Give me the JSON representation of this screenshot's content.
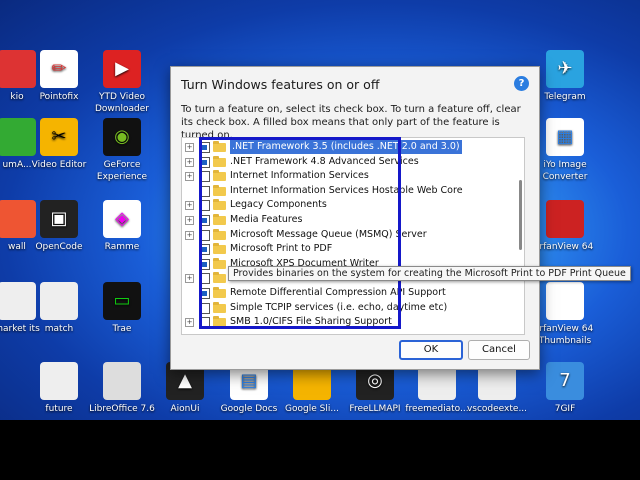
{
  "dialog": {
    "title": "Turn Windows features on or off",
    "help_glyph": "?",
    "description": "To turn a feature on, select its check box. To turn a feature off, clear its check box. A filled box means that only part of the feature is turned on.",
    "features": [
      {
        "label": ".NET Framework 3.5 (includes .NET 2.0 and 3.0)",
        "expandable": true,
        "state": "partial",
        "selected": true
      },
      {
        "label": ".NET Framework 4.8 Advanced Services",
        "expandable": true,
        "state": "partial",
        "selected": false
      },
      {
        "label": "Internet Information Services",
        "expandable": true,
        "state": "off",
        "selected": false
      },
      {
        "label": "Internet Information Services Hostable Web Core",
        "expandable": false,
        "state": "off",
        "selected": false
      },
      {
        "label": "Legacy Components",
        "expandable": true,
        "state": "off",
        "selected": false
      },
      {
        "label": "Media Features",
        "expandable": true,
        "state": "partial",
        "selected": false
      },
      {
        "label": "Microsoft Message Queue (MSMQ) Server",
        "expandable": true,
        "state": "off",
        "selected": false
      },
      {
        "label": "Microsoft Print to PDF",
        "expandable": false,
        "state": "partial",
        "selected": false
      },
      {
        "label": "Microsoft XPS Document Writer",
        "expandable": false,
        "state": "partial",
        "selected": false
      },
      {
        "label": "",
        "expandable": true,
        "state": "off",
        "selected": false
      },
      {
        "label": "Remote Differential Compression API Support",
        "expandable": false,
        "state": "partial",
        "selected": false
      },
      {
        "label": "Simple TCPIP services (i.e. echo, daytime etc)",
        "expandable": false,
        "state": "off",
        "selected": false
      },
      {
        "label": "SMB 1.0/CIFS File Sharing Support",
        "expandable": true,
        "state": "off",
        "selected": false
      }
    ],
    "tooltip": "Provides binaries on the system for creating the Microsoft Print to PDF Print Queue",
    "ok_label": "OK",
    "cancel_label": "Cancel"
  },
  "desktop_icons": [
    {
      "label": "kio",
      "glyph": "🎵",
      "color": "#d33"
    },
    {
      "label": "Pointofix",
      "glyph": "✏",
      "color": "#fff"
    },
    {
      "label": "YTD Video Downloader",
      "glyph": "▶",
      "color": "#d22"
    },
    {
      "label": "umA...",
      "glyph": "▮",
      "color": "#3a3"
    },
    {
      "label": "Video Editor",
      "glyph": "✂",
      "color": "#f5b400"
    },
    {
      "label": "GeForce Experience",
      "glyph": "◉",
      "color": "#111"
    },
    {
      "label": "wall",
      "glyph": "🔥",
      "color": "#e53"
    },
    {
      "label": "OpenCode",
      "glyph": "▣",
      "color": "#222"
    },
    {
      "label": "Ramme",
      "glyph": "📷",
      "color": "#e0e"
    },
    {
      "label": "market its",
      "glyph": "📄",
      "color": "#eee"
    },
    {
      "label": "match",
      "glyph": "📄",
      "color": "#eee"
    },
    {
      "label": "Trae",
      "glyph": "▭",
      "color": "#1c1"
    },
    {
      "label": "future",
      "glyph": "📄",
      "color": "#eee"
    },
    {
      "label": "LibreOffice 7.6",
      "glyph": "📝",
      "color": "#ddd"
    },
    {
      "label": "AionUi",
      "glyph": "▲",
      "color": "#222"
    },
    {
      "label": "Google Docs",
      "glyph": "📘",
      "color": "#fff"
    },
    {
      "label": "Google Sli...",
      "glyph": "📙",
      "color": "#f5b400"
    },
    {
      "label": "FreeLLMAPI",
      "glyph": "◎",
      "color": "#222"
    },
    {
      "label": "freemediato...",
      "glyph": "📄",
      "color": "#eee"
    },
    {
      "label": "vscodeexte...",
      "glyph": "📄",
      "color": "#eee"
    },
    {
      "label": "7GIF",
      "glyph": "7",
      "color": "#3a8dde"
    },
    {
      "label": "Telegram",
      "glyph": "✈",
      "color": "#2aa3e0"
    },
    {
      "label": "iYo Image Converter",
      "glyph": "▦",
      "color": "#fff"
    },
    {
      "label": "IrfanView 64",
      "glyph": "🐞",
      "color": "#c22"
    },
    {
      "label": "IrfanView 64 Thumbnails",
      "glyph": "🐼",
      "color": "#fff"
    }
  ]
}
